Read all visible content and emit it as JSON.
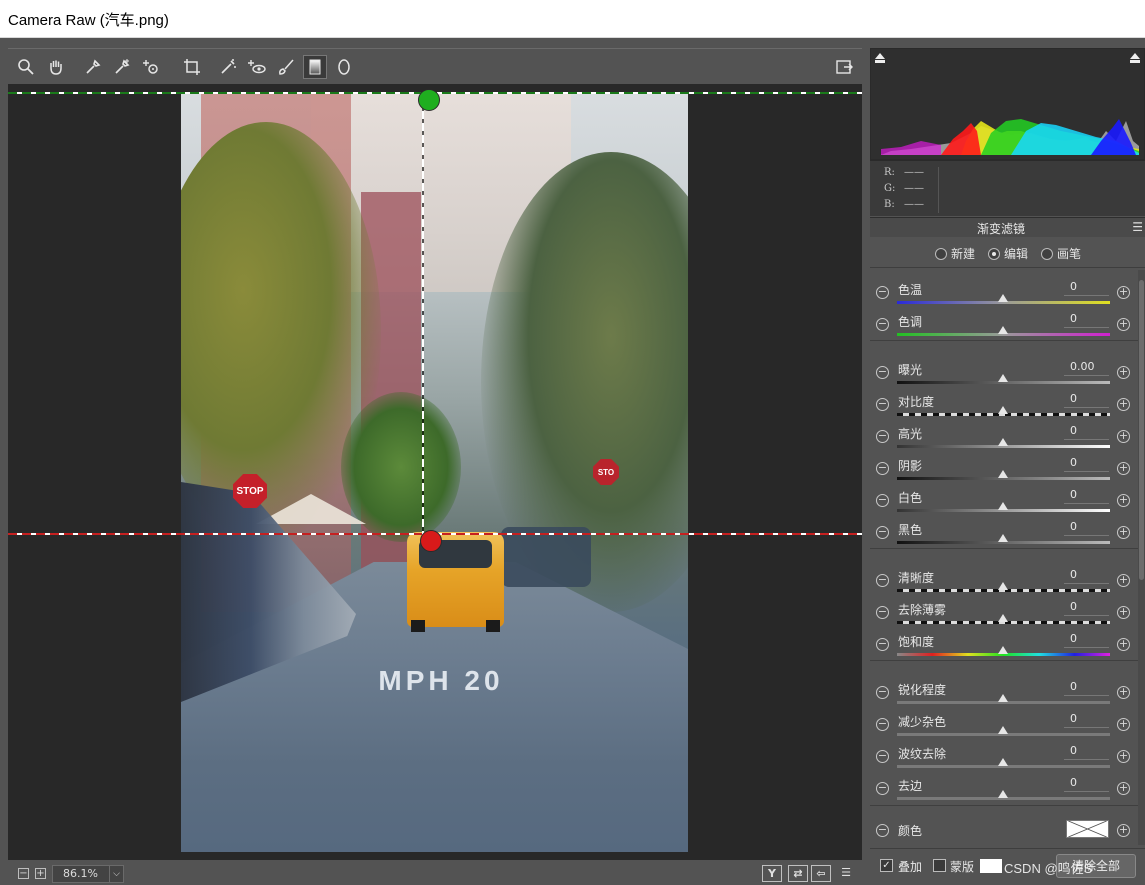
{
  "window": {
    "title": "Camera Raw (汽车.png)"
  },
  "toolbar": {
    "tools": [
      "zoom-icon",
      "hand-icon",
      "white-balance-icon",
      "color-sampler-icon",
      "targeted-adjustment-icon",
      "crop-icon",
      "spot-removal-icon",
      "red-eye-icon",
      "adjustment-brush-icon",
      "graduated-filter-icon",
      "radial-filter-icon"
    ],
    "active_tool": "graduated-filter-icon"
  },
  "preview": {
    "stop_sign": "STOP",
    "stop_sign_2": "STO",
    "road_marking": "MPH 20",
    "gradient": {
      "top_pin_color": "#1fae1f",
      "bottom_pin_color": "#d81a1a"
    }
  },
  "bottom": {
    "zoom_value": "86.1%",
    "zoom_dropdown": "⌵",
    "icons": [
      "Y",
      "⇄",
      "⇦",
      "☰"
    ]
  },
  "histogram": {
    "r_label": "R:",
    "g_label": "G:",
    "b_label": "B:",
    "r_value": "——",
    "g_value": "——",
    "b_value": "——"
  },
  "panel": {
    "title": "渐变滤镜",
    "modes": [
      {
        "label": "新建",
        "selected": false
      },
      {
        "label": "编辑",
        "selected": true
      },
      {
        "label": "画笔",
        "selected": false
      }
    ],
    "sliders": [
      {
        "label": "色温",
        "value": "0",
        "track": "temp"
      },
      {
        "label": "色调",
        "value": "0",
        "track": "tint"
      },
      {
        "label": "曝光",
        "value": "0.00",
        "track": "dark"
      },
      {
        "label": "对比度",
        "value": "0",
        "track": "contrast"
      },
      {
        "label": "高光",
        "value": "0",
        "track": "light"
      },
      {
        "label": "阴影",
        "value": "0",
        "track": "dark"
      },
      {
        "label": "白色",
        "value": "0",
        "track": "light"
      },
      {
        "label": "黑色",
        "value": "0",
        "track": "dark"
      },
      {
        "label": "清晰度",
        "value": "0",
        "track": "contrast"
      },
      {
        "label": "去除薄雾",
        "value": "0",
        "track": "contrast"
      },
      {
        "label": "饱和度",
        "value": "0",
        "track": "sat"
      },
      {
        "label": "锐化程度",
        "value": "0",
        "track": "gray"
      },
      {
        "label": "减少杂色",
        "value": "0",
        "track": "gray"
      },
      {
        "label": "波纹去除",
        "value": "0",
        "track": "gray"
      },
      {
        "label": "去边",
        "value": "0",
        "track": "gray"
      }
    ],
    "color_label": "颜色",
    "overlay_label": "叠加",
    "mask_label": "蒙版",
    "clear_all_label": "清除全部",
    "watermark": "CSDN @鸣佐S"
  }
}
